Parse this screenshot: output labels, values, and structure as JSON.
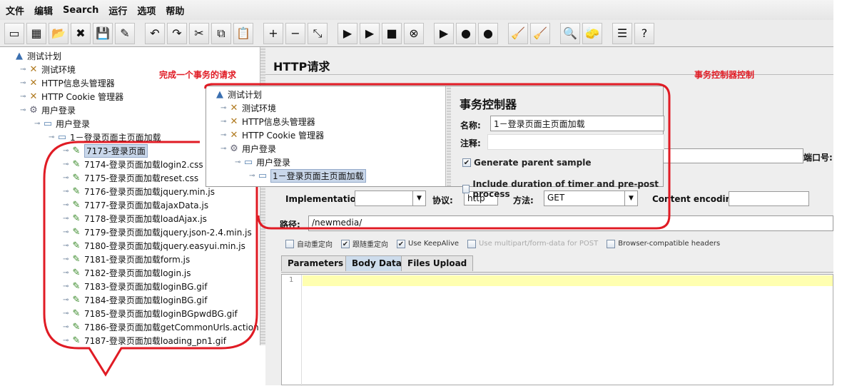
{
  "menu": [
    "文件",
    "编辑",
    "Search",
    "运行",
    "选项",
    "帮助"
  ],
  "toolbar": [
    {
      "icon": "new-icon",
      "g": "▭"
    },
    {
      "icon": "templates-icon",
      "g": "▦"
    },
    {
      "icon": "open-icon",
      "g": "📂"
    },
    {
      "icon": "close-icon",
      "g": "✖"
    },
    {
      "icon": "save-icon",
      "g": "💾"
    },
    {
      "icon": "save-as-icon",
      "g": "✎"
    },
    null,
    {
      "icon": "undo-icon",
      "g": "↶"
    },
    {
      "icon": "redo-icon",
      "g": "↷"
    },
    {
      "icon": "cut-icon",
      "g": "✂"
    },
    {
      "icon": "copy-icon",
      "g": "⧉"
    },
    {
      "icon": "paste-icon",
      "g": "📋"
    },
    null,
    {
      "icon": "expand-icon",
      "g": "+"
    },
    {
      "icon": "collapse-icon",
      "g": "−"
    },
    {
      "icon": "toggle-icon",
      "g": "⤡"
    },
    null,
    {
      "icon": "start-icon",
      "g": "▶"
    },
    {
      "icon": "start-no-pause-icon",
      "g": "▶"
    },
    {
      "icon": "stop-icon",
      "g": "■"
    },
    {
      "icon": "shutdown-icon",
      "g": "⊗"
    },
    null,
    {
      "icon": "remote-start-icon",
      "g": "▶"
    },
    {
      "icon": "remote-stop-icon",
      "g": "●"
    },
    {
      "icon": "remote-shutdown-icon",
      "g": "●"
    },
    null,
    {
      "icon": "clear-icon",
      "g": "🧹"
    },
    {
      "icon": "clear-all-icon",
      "g": "🧹"
    },
    null,
    {
      "icon": "search-icon",
      "g": "🔍"
    },
    {
      "icon": "reset-search-icon",
      "g": "🧽"
    },
    null,
    {
      "icon": "function-helper-icon",
      "g": "☰"
    },
    {
      "icon": "help-icon",
      "g": "?"
    }
  ],
  "tree": [
    {
      "label": "测试计划",
      "depth": 0,
      "icon": "test-plan-icon"
    },
    {
      "label": "测试环境",
      "depth": 1,
      "icon": "config-icon"
    },
    {
      "label": "HTTP信息头管理器",
      "depth": 1,
      "icon": "config-icon"
    },
    {
      "label": "HTTP Cookie 管理器",
      "depth": 1,
      "icon": "config-icon"
    },
    {
      "label": "用户登录",
      "depth": 1,
      "icon": "thread-group-icon"
    },
    {
      "label": "用户登录",
      "depth": 2,
      "icon": "controller-icon"
    },
    {
      "label": "1－登录页面主页面加载",
      "depth": 3,
      "icon": "controller-icon"
    },
    {
      "label": "7173-登录页面",
      "depth": 4,
      "icon": "sampler-icon",
      "selected": true
    },
    {
      "label": "7174-登录页面加载login2.css",
      "depth": 4,
      "icon": "sampler-icon"
    },
    {
      "label": "7175-登录页面加载reset.css",
      "depth": 4,
      "icon": "sampler-icon"
    },
    {
      "label": "7176-登录页面加载jquery.min.js",
      "depth": 4,
      "icon": "sampler-icon"
    },
    {
      "label": "7177-登录页面加载ajaxData.js",
      "depth": 4,
      "icon": "sampler-icon"
    },
    {
      "label": "7178-登录页面加载loadAjax.js",
      "depth": 4,
      "icon": "sampler-icon"
    },
    {
      "label": "7179-登录页面加载jquery.json-2.4.min.js",
      "depth": 4,
      "icon": "sampler-icon"
    },
    {
      "label": "7180-登录页面加载jquery.easyui.min.js",
      "depth": 4,
      "icon": "sampler-icon"
    },
    {
      "label": "7181-登录页面加载form.js",
      "depth": 4,
      "icon": "sampler-icon"
    },
    {
      "label": "7182-登录页面加载login.js",
      "depth": 4,
      "icon": "sampler-icon"
    },
    {
      "label": "7183-登录页面加载loginBG.gif",
      "depth": 4,
      "icon": "sampler-icon"
    },
    {
      "label": "7184-登录页面加载loginBG.gif",
      "depth": 4,
      "icon": "sampler-icon"
    },
    {
      "label": "7185-登录页面加载loginBGpwdBG.gif",
      "depth": 4,
      "icon": "sampler-icon"
    },
    {
      "label": "7186-登录页面加载getCommonUrls.action",
      "depth": 4,
      "icon": "sampler-icon"
    },
    {
      "label": "7187-登录页面加载loading_pn1.gif",
      "depth": 4,
      "icon": "sampler-icon"
    }
  ],
  "http": {
    "title": "HTTP请求",
    "port_label": "端口号:",
    "impl_label": "Implementation:",
    "impl_value": "",
    "protocol_label": "协议:",
    "protocol_value": "http",
    "method_label": "方法:",
    "method_value": "GET",
    "encoding_label": "Content encoding:",
    "encoding_value": "",
    "path_label": "路径:",
    "path_value": "/newmedia/",
    "options": [
      {
        "label": "自动重定向",
        "checked": false,
        "disabled": false
      },
      {
        "label": "跟随重定向",
        "checked": true,
        "disabled": false
      },
      {
        "label": "Use KeepAlive",
        "checked": true,
        "disabled": false
      },
      {
        "label": "Use multipart/form-data for POST",
        "checked": false,
        "disabled": true
      },
      {
        "label": "Browser-compatible headers",
        "checked": false,
        "disabled": false
      }
    ],
    "tabs": [
      "Parameters",
      "Body Data",
      "Files Upload"
    ],
    "active_tab": 1,
    "line_number": "1"
  },
  "inset": {
    "tree": [
      {
        "label": "测试计划",
        "depth": 0,
        "icon": "test-plan-icon"
      },
      {
        "label": "测试环境",
        "depth": 1,
        "icon": "config-icon"
      },
      {
        "label": "HTTP信息头管理器",
        "depth": 1,
        "icon": "config-icon"
      },
      {
        "label": "HTTP Cookie 管理器",
        "depth": 1,
        "icon": "config-icon"
      },
      {
        "label": "用户登录",
        "depth": 1,
        "icon": "thread-group-icon"
      },
      {
        "label": "用户登录",
        "depth": 2,
        "icon": "controller-icon"
      },
      {
        "label": "1－登录页面主页面加载",
        "depth": 3,
        "icon": "controller-icon",
        "selected": true
      }
    ],
    "title": "事务控制器",
    "name_label": "名称:",
    "name_value": "1－登录页面主页面加载",
    "comment_label": "注释:",
    "comment_value": "",
    "generate_parent": {
      "label": "Generate parent sample",
      "checked": true
    },
    "include_timers": {
      "label": "Include duration of timer and pre-post process",
      "checked": false
    }
  },
  "annotations": {
    "left": "完成一个事务的请求",
    "right": "事务控制器控制",
    "color": "#e01b24"
  }
}
